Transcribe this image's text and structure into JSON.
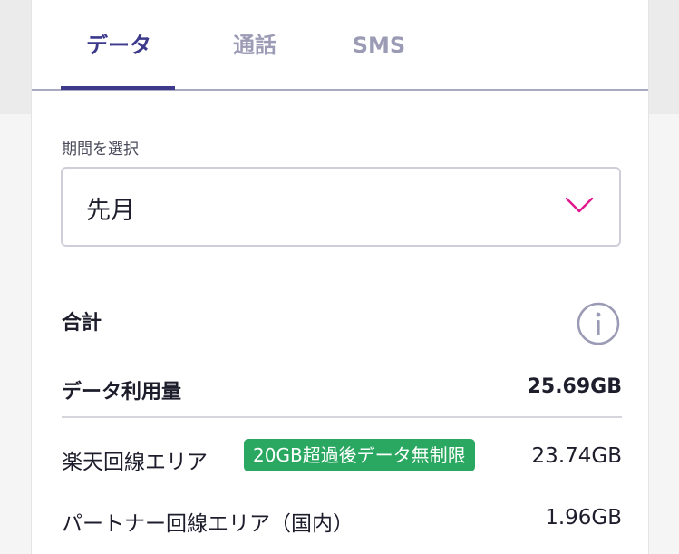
{
  "tabs": [
    {
      "label": "データ",
      "active": true
    },
    {
      "label": "通話",
      "active": false
    },
    {
      "label": "SMS",
      "active": false
    }
  ],
  "period": {
    "label": "期間を選択",
    "selected": "先月"
  },
  "summary": {
    "title": "合計",
    "usage_label": "データ利用量",
    "usage_value": "25.69GB"
  },
  "breakdown": [
    {
      "label": "楽天回線エリア",
      "badge": "20GB超過後データ無制限",
      "value": "23.74GB"
    },
    {
      "label": "パートナー回線エリア（国内）",
      "value": "1.96GB"
    }
  ],
  "colors": {
    "accent": "#3d3a8c",
    "chevron": "#e0168c",
    "badge": "#2aa861",
    "inactive_tab": "#9b9bb5"
  },
  "icons": {
    "select_chevron": "chevron-down-icon",
    "info": "info-icon"
  }
}
